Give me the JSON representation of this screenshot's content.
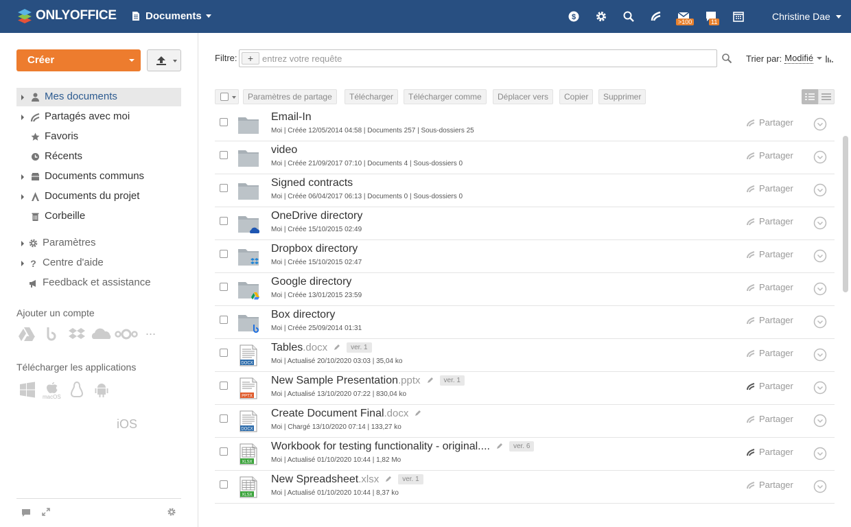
{
  "header": {
    "brand": "ONLYOFFICE",
    "product": "Documents",
    "mail_badge": ">100",
    "chat_badge": "11",
    "user": "Christine Dae"
  },
  "sidebar": {
    "create_label": "Créer",
    "nav": [
      {
        "label": "Mes documents",
        "icon": "person-icon",
        "selected": true
      },
      {
        "label": "Partagés avec moi",
        "icon": "share-icon"
      },
      {
        "label": "Favoris",
        "icon": "star-icon"
      },
      {
        "label": "Récents",
        "icon": "clock-icon"
      },
      {
        "label": "Documents communs",
        "icon": "common-docs-icon"
      },
      {
        "label": "Documents du projet",
        "icon": "project-icon"
      },
      {
        "label": "Corbeille",
        "icon": "trash-icon"
      }
    ],
    "nav2": [
      {
        "label": "Paramètres",
        "icon": "gear-icon"
      },
      {
        "label": "Centre d'aide",
        "icon": "question-icon"
      },
      {
        "label": "Feedback et assistance",
        "icon": "megaphone-icon"
      }
    ],
    "add_account": "Ajouter un compte",
    "download_apps": "Télécharger les applications",
    "macos_label": "macOS",
    "ios_label": "iOS",
    "more_label": "..."
  },
  "filter": {
    "label": "Filtre:",
    "placeholder": "entrez votre requête",
    "sort_label": "Trier par:",
    "sort_value": "Modifié"
  },
  "toolbar": {
    "share": "Paramètres de partage",
    "download": "Télécharger",
    "download_as": "Télécharger comme",
    "move": "Déplacer vers",
    "copy": "Copier",
    "delete": "Supprimer"
  },
  "share_label": "Partager",
  "files": [
    {
      "name": "Email-In",
      "ext": "",
      "meta": "Moi | Créée 12/05/2014 04:58 | Documents 257 | Sous-dossiers 25",
      "type": "folder"
    },
    {
      "name": "video",
      "ext": "",
      "meta": "Moi | Créée 21/09/2017 07:10 | Documents 4 | Sous-dossiers 0",
      "type": "folder"
    },
    {
      "name": "Signed contracts",
      "ext": "",
      "meta": "Moi | Créée 06/04/2017 06:13 | Documents 0 | Sous-dossiers 0",
      "type": "folder"
    },
    {
      "name": "OneDrive directory",
      "ext": "",
      "meta": "Moi | Créée 15/10/2015 02:49",
      "type": "onedrive"
    },
    {
      "name": "Dropbox directory",
      "ext": "",
      "meta": "Moi | Créée 15/10/2015 02:47",
      "type": "dropbox"
    },
    {
      "name": "Google directory",
      "ext": "",
      "meta": "Moi | Créée 13/01/2015 23:59",
      "type": "google"
    },
    {
      "name": "Box directory",
      "ext": "",
      "meta": "Moi | Créée 25/09/2014 01:31",
      "type": "box"
    },
    {
      "name": "Tables",
      "ext": ".docx",
      "meta": "Moi | Actualisé 20/10/2020 03:03 | 35,04 ko",
      "type": "docx",
      "version": "ver. 1",
      "label": "DOCX"
    },
    {
      "name": "New Sample Presentation",
      "ext": ".pptx",
      "meta": "Moi | Actualisé 13/10/2020 07:22 | 830,04 ko",
      "type": "pptx",
      "version": "ver. 1",
      "label": "PPTX",
      "shared": true
    },
    {
      "name": "Create Document Final",
      "ext": ".docx",
      "meta": "Moi | Chargé 13/10/2020 07:14 | 133,27 ko",
      "type": "docx",
      "label": "DOCX"
    },
    {
      "name": "Workbook for testing functionality - original....",
      "ext": "",
      "meta": "Moi | Actualisé 01/10/2020 10:44 | 1,82 Mo",
      "type": "xlsx",
      "version": "ver. 6",
      "label": "XLSX",
      "shared": true
    },
    {
      "name": "New Spreadsheet",
      "ext": ".xlsx",
      "meta": "Moi | Actualisé 01/10/2020 10:44 | 8,37 ko",
      "type": "xlsx",
      "version": "ver. 1",
      "label": "XLSX"
    }
  ]
}
